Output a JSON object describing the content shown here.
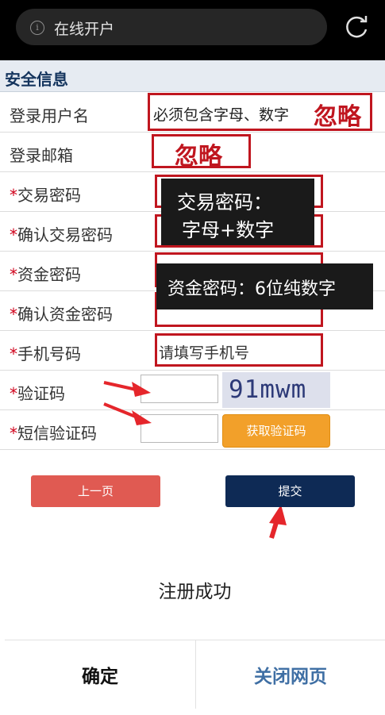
{
  "browser": {
    "url_title": "在线开户"
  },
  "section": {
    "title": "安全信息"
  },
  "form": {
    "username_label": "登录用户名",
    "username_hint": "必须包含字母、数字",
    "email_label": "登录邮箱",
    "trade_pwd_label": "交易密码",
    "confirm_trade_pwd_label": "确认交易密码",
    "fund_pwd_label": "资金密码",
    "confirm_fund_pwd_label": "确认资金密码",
    "phone_label": "手机号码",
    "phone_placeholder": "请填写手机号",
    "captcha_label": "验证码",
    "captcha_image_text": "91mwm",
    "sms_label": "短信验证码",
    "sms_button": "获取验证码",
    "required_mark": "*"
  },
  "annotations": {
    "ignore_1": "忽略",
    "ignore_2": "忽略",
    "trade_pwd_note_line1": "交易密码：",
    "trade_pwd_note_line2": "字母+数字",
    "fund_pwd_note": "资金密码：6位纯数字",
    "arrow_color": "#e5262b",
    "box_color": "#c0161f"
  },
  "buttons": {
    "prev": "上一页",
    "submit": "提交"
  },
  "modal": {
    "message": "注册成功",
    "ok": "确定",
    "close_page": "关闭网页"
  }
}
